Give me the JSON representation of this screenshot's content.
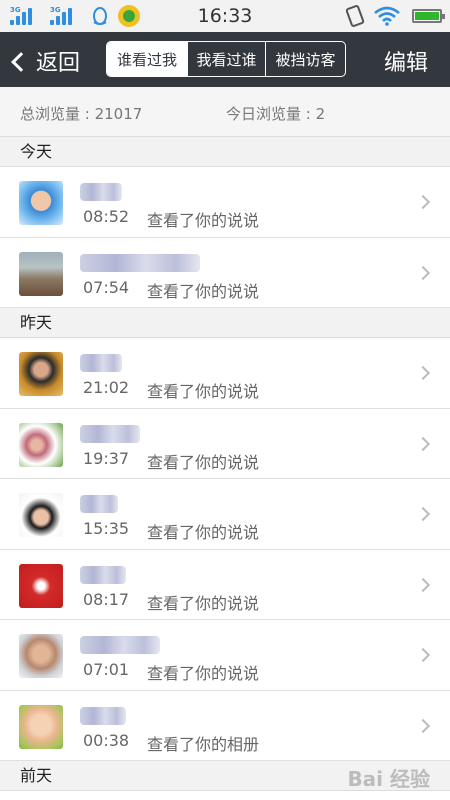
{
  "status_bar": {
    "time": "16:33",
    "signal_labels": [
      "3G",
      "3G"
    ]
  },
  "nav": {
    "back_label": "返回",
    "tabs": [
      {
        "label": "谁看过我",
        "active": true
      },
      {
        "label": "我看过谁",
        "active": false
      },
      {
        "label": "被挡访客",
        "active": false
      }
    ],
    "edit_label": "编辑"
  },
  "stats": {
    "total": "总浏览量 : 21017",
    "today": "今日浏览量 : 2"
  },
  "sections": [
    {
      "title": "今天",
      "items": [
        {
          "time": "08:52",
          "action": "查看了你的说说"
        },
        {
          "time": "07:54",
          "action": "查看了你的说说"
        }
      ]
    },
    {
      "title": "昨天",
      "items": [
        {
          "time": "21:02",
          "action": "查看了你的说说"
        },
        {
          "time": "19:37",
          "action": "查看了你的说说"
        },
        {
          "time": "15:35",
          "action": "查看了你的说说"
        },
        {
          "time": "08:17",
          "action": "查看了你的说说"
        },
        {
          "time": "07:01",
          "action": "查看了你的说说"
        },
        {
          "time": "00:38",
          "action": "查看了你的相册"
        }
      ]
    },
    {
      "title": "前天",
      "items": []
    }
  ],
  "watermark": "Bai 经验"
}
